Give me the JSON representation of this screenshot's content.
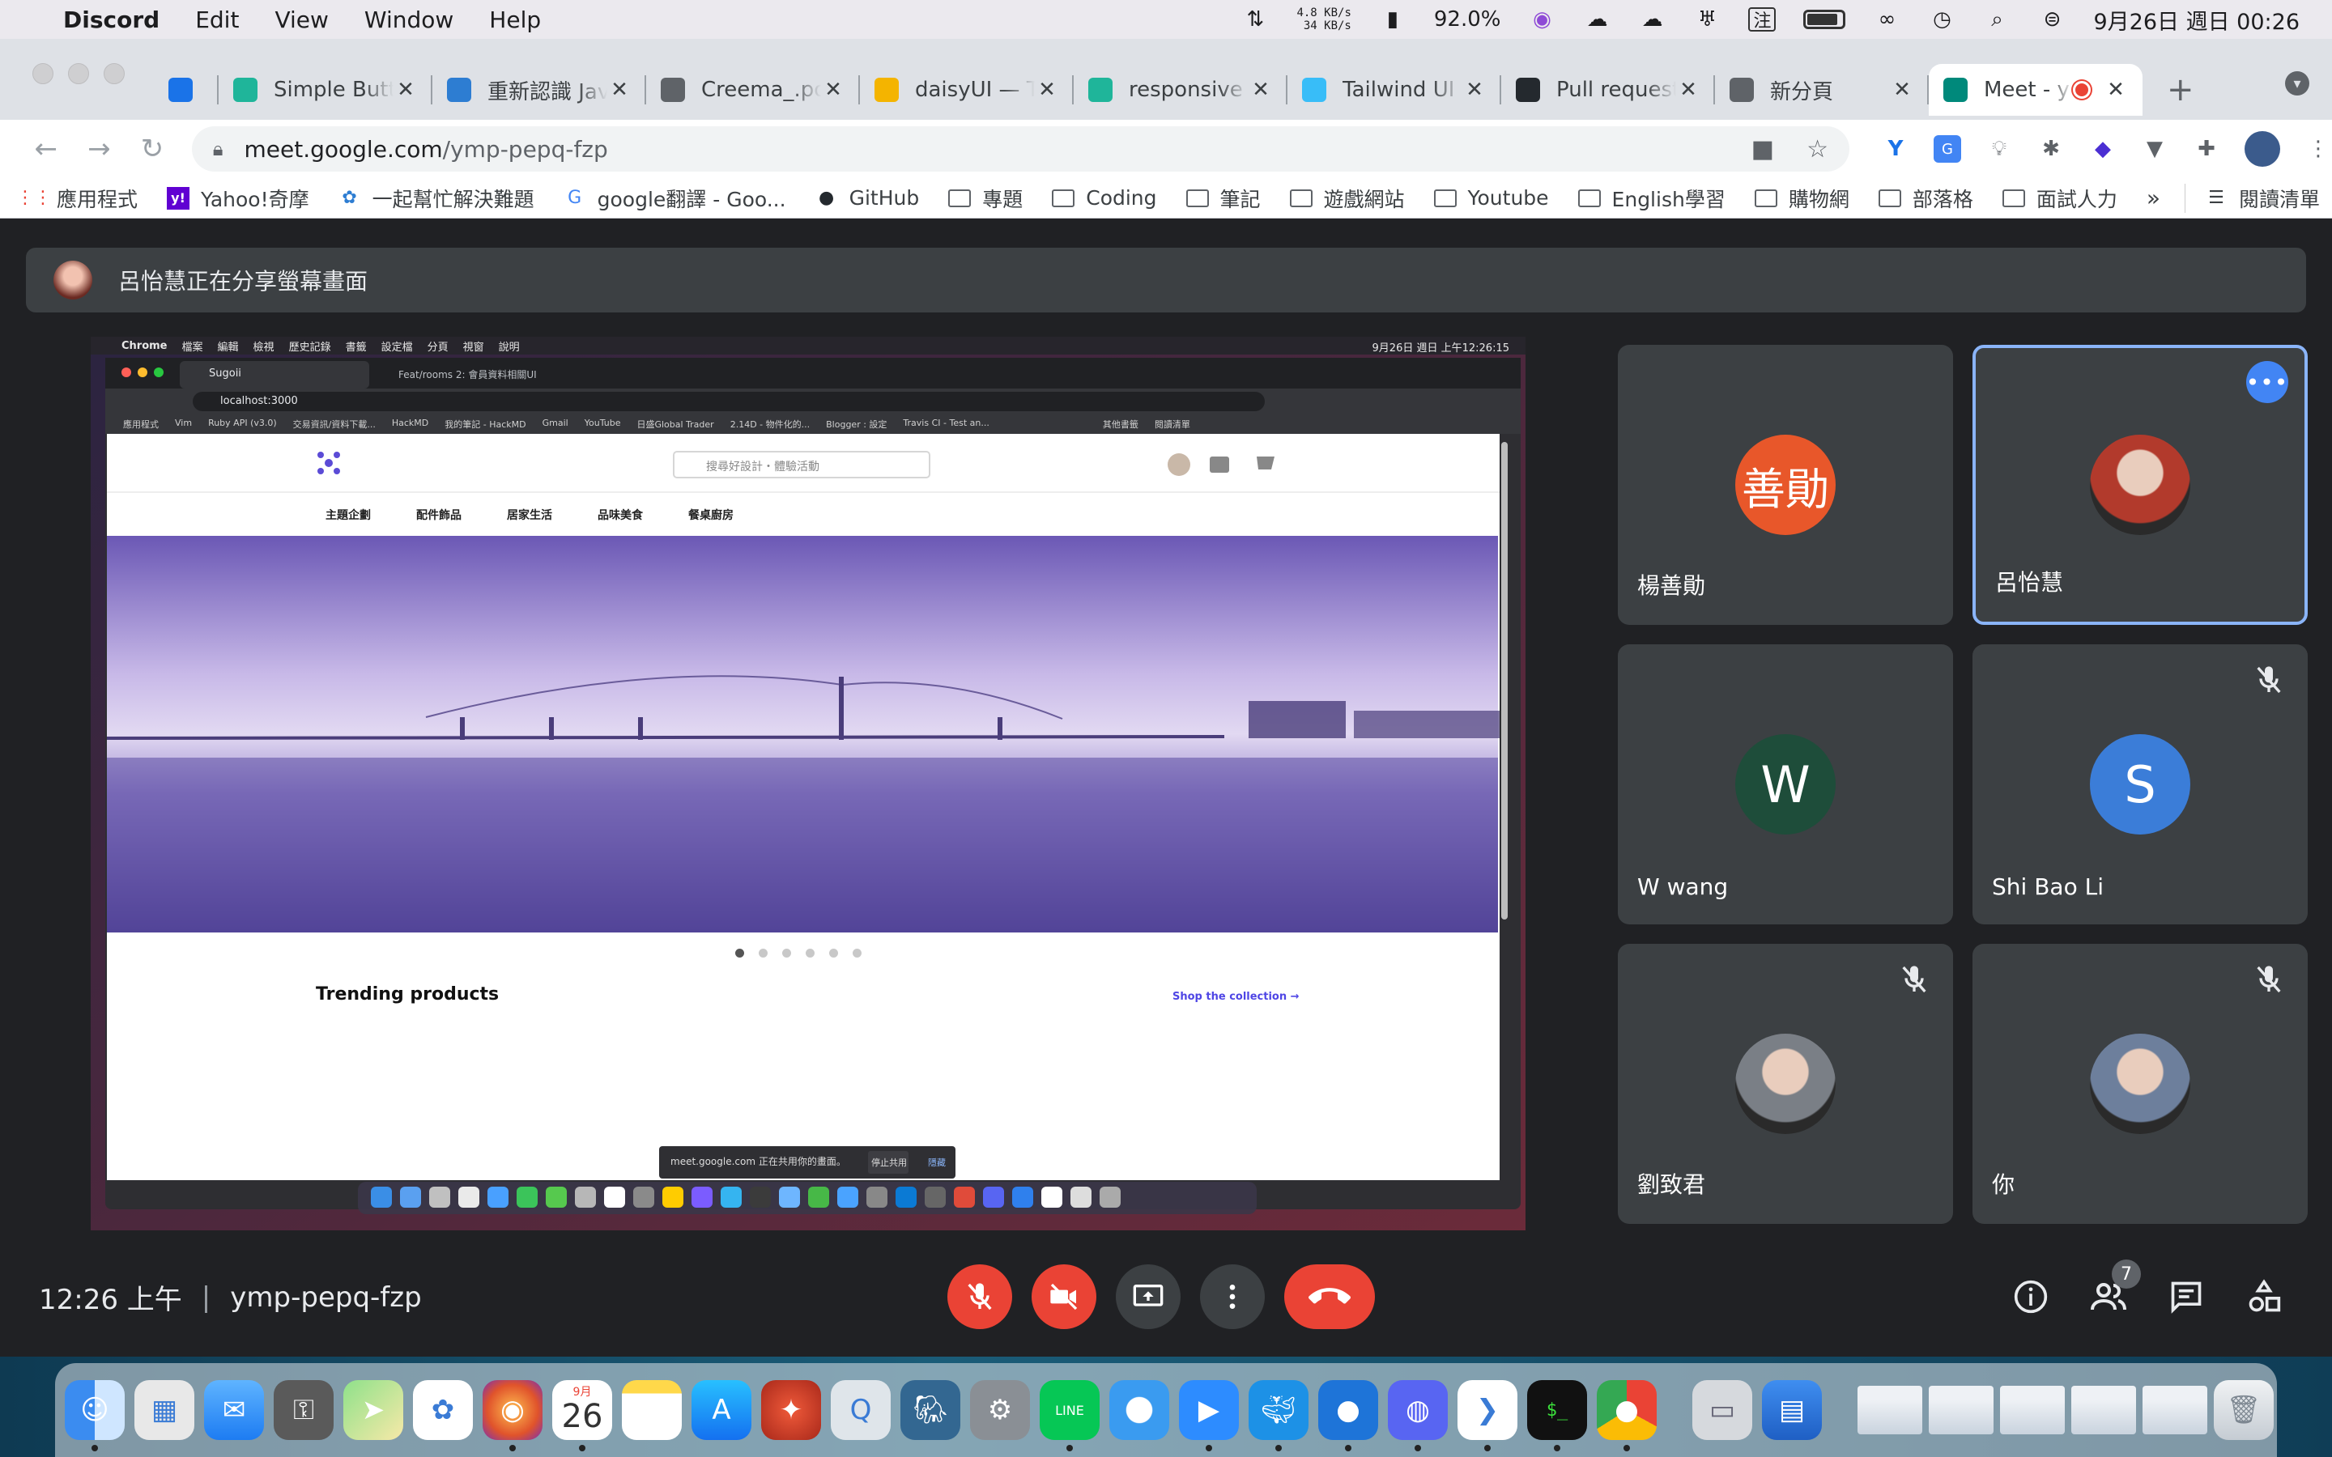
{
  "menubar": {
    "app": "Discord",
    "menus": [
      "Edit",
      "View",
      "Window",
      "Help"
    ],
    "net_up": "4.8 KB/s",
    "net_down": "34 KB/s",
    "battery_pct": "92.0%",
    "input_method": "注",
    "datetime": "9月26日 週日 00:26"
  },
  "tabs": [
    {
      "title": "",
      "favicon": "vercel-v-icon",
      "color": "#1a73e8"
    },
    {
      "title": "Simple Butto",
      "favicon": "leaf-icon",
      "color": "#1fb59a"
    },
    {
      "title": "重新認識 Jav",
      "favicon": "it-icon",
      "color": "#2d7dd2"
    },
    {
      "title": "Creema_.po",
      "favicon": "globe-icon",
      "color": "#5f6368"
    },
    {
      "title": "daisyUI — T",
      "favicon": "daisy-icon",
      "color": "#f4b400"
    },
    {
      "title": "responsive t",
      "favicon": "leaf-icon",
      "color": "#1fb59a"
    },
    {
      "title": "Tailwind UI -",
      "favicon": "tailwind-icon",
      "color": "#38bdf8"
    },
    {
      "title": "Pull request",
      "favicon": "github-icon",
      "color": "#24292e"
    },
    {
      "title": "新分頁",
      "favicon": "chrome-icon",
      "color": "#5f6368"
    },
    {
      "title": "Meet - y",
      "favicon": "meet-icon",
      "color": "#00897b",
      "active": true
    }
  ],
  "omnibox": {
    "host": "meet.google.com",
    "path": "/ymp-pepq-fzp"
  },
  "bookmarks": [
    {
      "label": "應用程式",
      "icon": "apps-grid-icon"
    },
    {
      "label": "Yahoo!奇摩",
      "icon": "yahoo-icon"
    },
    {
      "label": "一起幫忙解決難題",
      "icon": "ithome-icon"
    },
    {
      "label": "google翻譯 - Goo...",
      "icon": "google-icon"
    },
    {
      "label": "GitHub",
      "icon": "github-icon"
    },
    {
      "label": "專題",
      "icon": "folder-icon"
    },
    {
      "label": "Coding",
      "icon": "folder-icon"
    },
    {
      "label": "筆記",
      "icon": "folder-icon"
    },
    {
      "label": "遊戲網站",
      "icon": "folder-icon"
    },
    {
      "label": "Youtube",
      "icon": "folder-icon"
    },
    {
      "label": "English學習",
      "icon": "folder-icon"
    },
    {
      "label": "購物網",
      "icon": "folder-icon"
    },
    {
      "label": "部落格",
      "icon": "folder-icon"
    },
    {
      "label": "面試人力",
      "icon": "folder-icon"
    }
  ],
  "bookmarks_more": "»",
  "reading_list": "閱讀清單",
  "banner": {
    "text": "呂怡慧正在分享螢幕畫面"
  },
  "shared_screen": {
    "mac_menus": [
      "Chrome",
      "檔案",
      "編輯",
      "檢視",
      "歷史記錄",
      "書籤",
      "設定檔",
      "分頁",
      "視窗",
      "說明"
    ],
    "mac_clock": "9月26日 週日 上午12:26:15",
    "tabs": [
      "Sugoii",
      "Feat/rooms 2: 會員資料相關UI"
    ],
    "url": "localhost:3000",
    "bookmarks": [
      "應用程式",
      "Vim",
      "Ruby API (v3.0)",
      "交易資訊/資料下載...",
      "HackMD",
      "我的筆記 - HackMD",
      "Gmail",
      "YouTube",
      "日盛Global Trader",
      "2.14D - 物件化的...",
      "Blogger : 設定",
      "Travis CI - Test an...",
      "其他書籤",
      "閱讀清單"
    ],
    "search_placeholder": "搜尋好設計・體驗活動",
    "nav": [
      "主題企劃",
      "配件飾品",
      "居家生活",
      "品味美食",
      "餐桌廚房"
    ],
    "carousel_slide": 1,
    "carousel_total": 6,
    "trending_title": "Trending products",
    "shop_link": "Shop the collection →",
    "share_notice": "meet.google.com 正在共用你的畫面。",
    "stop_share": "停止共用",
    "hide": "隱藏"
  },
  "participants": [
    {
      "name": "楊善勛",
      "avatar_text": "善勛",
      "avatar_color": "#e8572a",
      "muted": false
    },
    {
      "name": "呂怡慧",
      "avatar_text": "",
      "avatar_color": "#b23a2c",
      "muted": false,
      "highlighted": true
    },
    {
      "name": "W wang",
      "avatar_text": "W",
      "avatar_color": "#1e4d3a",
      "muted": false
    },
    {
      "name": "Shi Bao Li",
      "avatar_text": "S",
      "avatar_color": "#3b7dd8",
      "muted": true
    },
    {
      "name": "劉致君",
      "avatar_text": "",
      "avatar_color": "#7a7f86",
      "muted": true
    },
    {
      "name": "你",
      "avatar_text": "",
      "avatar_color": "#6d7f9c",
      "muted": true
    }
  ],
  "footer": {
    "time": "12:26 上午",
    "separator": "|",
    "meeting_code": "ymp-pepq-fzp",
    "participant_count": "7"
  },
  "dock": {
    "calendar_month": "9月",
    "calendar_day": "26",
    "apps": [
      "finder-icon",
      "launchpad-icon",
      "mail-icon",
      "keychain-icon",
      "maps-icon",
      "photos-icon",
      "firefox-icon",
      "calendar-icon",
      "notes-icon",
      "app-store-icon",
      "safari-compass-icon",
      "quicktime-icon",
      "postgres-icon",
      "system-preferences-icon",
      "line-icon",
      "safari-icon",
      "zoom-icon",
      "docker-icon",
      "proxy-icon",
      "discord-icon",
      "vscode-icon",
      "terminal-icon",
      "chrome-icon"
    ]
  }
}
